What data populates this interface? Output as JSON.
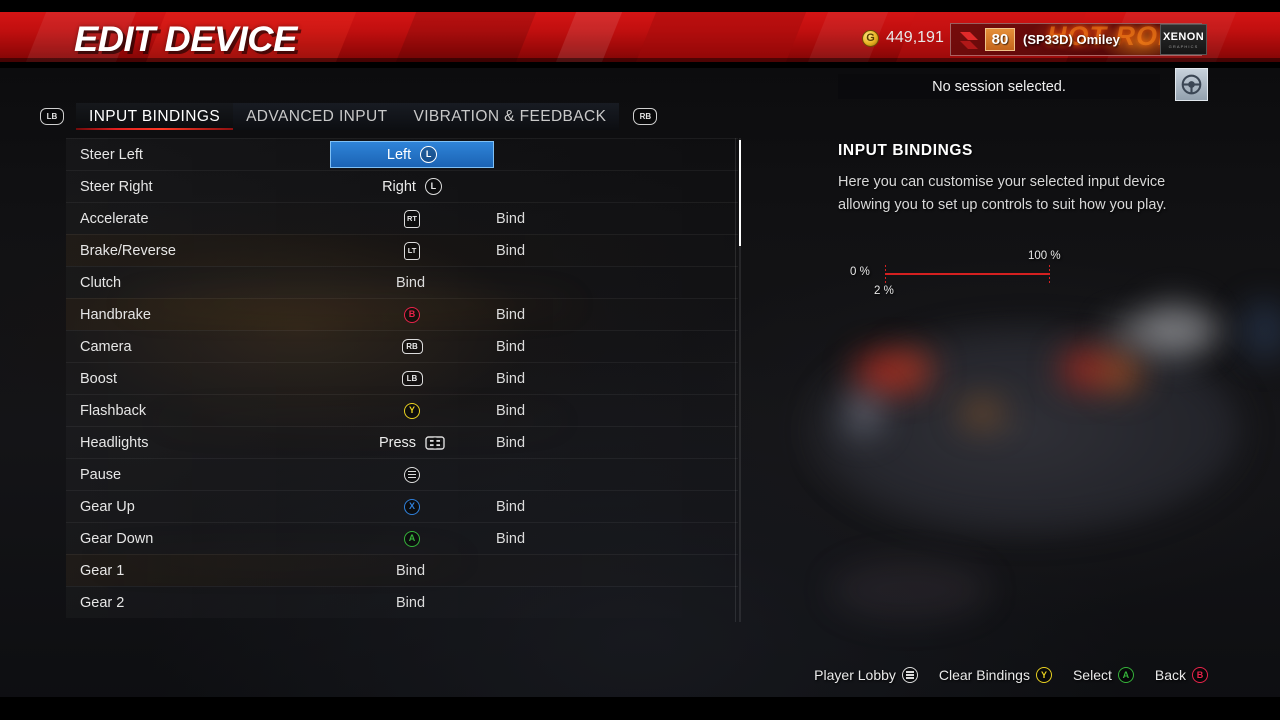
{
  "header": {
    "title": "EDIT DEVICE",
    "gold_icon": "gold-coin-icon",
    "gold_amount": "449,191",
    "player": {
      "emblem_icon": "clan-emblem-icon",
      "level": "80",
      "gamertag": "(SP33D) Omiley",
      "flame_text": "HOT ROD"
    },
    "brand_badge": {
      "name": "XENON",
      "sub": "GRAPHICS"
    },
    "accent_red": "#d51414"
  },
  "tabs": {
    "prev_bumper": "LB",
    "next_bumper": "RB",
    "items": [
      {
        "label": "INPUT BINDINGS",
        "active": true
      },
      {
        "label": "ADVANCED INPUT",
        "active": false
      },
      {
        "label": "VIBRATION & FEEDBACK",
        "active": false
      }
    ]
  },
  "bindings": {
    "rows": [
      {
        "action": "Steer Left",
        "value": "Left",
        "icon": "left-stick-icon",
        "icon_type": "stick",
        "icon_text": "L",
        "bind": "",
        "selected": true,
        "warm": false
      },
      {
        "action": "Steer Right",
        "value": "Right",
        "icon": "left-stick-icon",
        "icon_type": "stick",
        "icon_text": "L",
        "bind": "",
        "selected": false,
        "warm": false
      },
      {
        "action": "Accelerate",
        "value": "",
        "icon": "right-trigger-icon",
        "icon_type": "trig",
        "icon_text": "RT",
        "bind": "Bind",
        "selected": false,
        "warm": false
      },
      {
        "action": "Brake/Reverse",
        "value": "",
        "icon": "left-trigger-icon",
        "icon_type": "trig",
        "icon_text": "LT",
        "bind": "Bind",
        "selected": false,
        "warm": true
      },
      {
        "action": "Clutch",
        "value": "",
        "icon": "",
        "icon_type": "none",
        "icon_text": "",
        "bind": "Bind",
        "selected": false,
        "warm": false,
        "bind_mid": true
      },
      {
        "action": "Handbrake",
        "value": "",
        "icon": "b-button-icon",
        "icon_type": "face-b",
        "icon_text": "B",
        "bind": "Bind",
        "selected": false,
        "warm": true
      },
      {
        "action": "Camera",
        "value": "",
        "icon": "rb-bumper-icon",
        "icon_type": "bump",
        "icon_text": "RB",
        "bind": "Bind",
        "selected": false,
        "warm": false
      },
      {
        "action": "Boost",
        "value": "",
        "icon": "lb-bumper-icon",
        "icon_type": "bump",
        "icon_text": "LB",
        "bind": "Bind",
        "selected": false,
        "warm": false
      },
      {
        "action": "Flashback",
        "value": "",
        "icon": "y-button-icon",
        "icon_type": "face-y",
        "icon_text": "Y",
        "bind": "Bind",
        "selected": false,
        "warm": false
      },
      {
        "action": "Headlights",
        "value": "Press",
        "icon": "dpad-icon",
        "icon_type": "dpad",
        "icon_text": "",
        "bind": "Bind",
        "selected": false,
        "warm": false
      },
      {
        "action": "Pause",
        "value": "",
        "icon": "menu-button-icon",
        "icon_type": "menu",
        "icon_text": "",
        "bind": "",
        "selected": false,
        "warm": false
      },
      {
        "action": "Gear Up",
        "value": "",
        "icon": "x-button-icon",
        "icon_type": "face-x",
        "icon_text": "X",
        "bind": "Bind",
        "selected": false,
        "warm": false
      },
      {
        "action": "Gear Down",
        "value": "",
        "icon": "a-button-icon",
        "icon_type": "face-a",
        "icon_text": "A",
        "bind": "Bind",
        "selected": false,
        "warm": false
      },
      {
        "action": "Gear 1",
        "value": "",
        "icon": "",
        "icon_type": "none",
        "icon_text": "",
        "bind": "Bind",
        "selected": false,
        "warm": true,
        "bind_mid": true
      },
      {
        "action": "Gear 2",
        "value": "",
        "icon": "",
        "icon_type": "none",
        "icon_text": "",
        "bind": "Bind",
        "selected": false,
        "warm": false,
        "bind_mid": true
      }
    ]
  },
  "right_panel": {
    "session_status": "No session selected.",
    "device_icon": "steering-wheel-icon",
    "info_title": "INPUT BINDINGS",
    "info_body": "Here you can customise your selected input device allowing you to set up controls to suit how you play.",
    "gauge": {
      "min_label": "0 %",
      "max_label": "100 %",
      "value_label": "2 %",
      "color": "#d42020"
    }
  },
  "footer": {
    "hints": [
      {
        "label": "Player Lobby",
        "icon": "menu-button-icon",
        "icon_type": "menu",
        "icon_text": ""
      },
      {
        "label": "Clear Bindings",
        "icon": "y-button-icon",
        "icon_type": "face-y",
        "icon_text": "Y"
      },
      {
        "label": "Select",
        "icon": "a-button-icon",
        "icon_type": "face-a",
        "icon_text": "A"
      },
      {
        "label": "Back",
        "icon": "b-button-icon",
        "icon_type": "face-b",
        "icon_text": "B"
      }
    ]
  }
}
